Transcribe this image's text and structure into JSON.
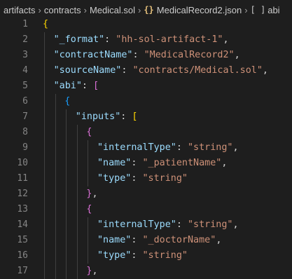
{
  "breadcrumb": {
    "parts": [
      "artifacts",
      "contracts",
      "Medical.sol",
      "MedicalRecord2.json",
      "abi"
    ],
    "json_icon": "{}",
    "array_icon": "[ ]"
  },
  "lines": [
    {
      "no": "1",
      "tokens": [
        {
          "t": "{",
          "c": "b1"
        }
      ],
      "indent": 0
    },
    {
      "no": "2",
      "tokens": [
        {
          "t": "\"_format\"",
          "c": "t-key"
        },
        {
          "t": ": ",
          "c": "t-punc"
        },
        {
          "t": "\"hh-sol-artifact-1\"",
          "c": "t-str"
        },
        {
          "t": ",",
          "c": "t-punc"
        }
      ],
      "indent": 1
    },
    {
      "no": "3",
      "tokens": [
        {
          "t": "\"contractName\"",
          "c": "t-key"
        },
        {
          "t": ": ",
          "c": "t-punc"
        },
        {
          "t": "\"MedicalRecord2\"",
          "c": "t-str"
        },
        {
          "t": ",",
          "c": "t-punc"
        }
      ],
      "indent": 1
    },
    {
      "no": "4",
      "tokens": [
        {
          "t": "\"sourceName\"",
          "c": "t-key"
        },
        {
          "t": ": ",
          "c": "t-punc"
        },
        {
          "t": "\"contracts/Medical.sol\"",
          "c": "t-str"
        },
        {
          "t": ",",
          "c": "t-punc"
        }
      ],
      "indent": 1
    },
    {
      "no": "5",
      "tokens": [
        {
          "t": "\"abi\"",
          "c": "t-key"
        },
        {
          "t": ": ",
          "c": "t-punc"
        },
        {
          "t": "[",
          "c": "b2"
        }
      ],
      "indent": 1
    },
    {
      "no": "6",
      "tokens": [
        {
          "t": "{",
          "c": "b3"
        }
      ],
      "indent": 2
    },
    {
      "no": "7",
      "tokens": [
        {
          "t": "\"inputs\"",
          "c": "t-key"
        },
        {
          "t": ": ",
          "c": "t-punc"
        },
        {
          "t": "[",
          "c": "b1"
        }
      ],
      "indent": 3
    },
    {
      "no": "8",
      "tokens": [
        {
          "t": "{",
          "c": "b2"
        }
      ],
      "indent": 4
    },
    {
      "no": "9",
      "tokens": [
        {
          "t": "\"internalType\"",
          "c": "t-key"
        },
        {
          "t": ": ",
          "c": "t-punc"
        },
        {
          "t": "\"string\"",
          "c": "t-str"
        },
        {
          "t": ",",
          "c": "t-punc"
        }
      ],
      "indent": 5
    },
    {
      "no": "10",
      "tokens": [
        {
          "t": "\"name\"",
          "c": "t-key"
        },
        {
          "t": ": ",
          "c": "t-punc"
        },
        {
          "t": "\"_patientName\"",
          "c": "t-str"
        },
        {
          "t": ",",
          "c": "t-punc"
        }
      ],
      "indent": 5
    },
    {
      "no": "11",
      "tokens": [
        {
          "t": "\"type\"",
          "c": "t-key"
        },
        {
          "t": ": ",
          "c": "t-punc"
        },
        {
          "t": "\"string\"",
          "c": "t-str"
        }
      ],
      "indent": 5
    },
    {
      "no": "12",
      "tokens": [
        {
          "t": "}",
          "c": "b2"
        },
        {
          "t": ",",
          "c": "t-punc"
        }
      ],
      "indent": 4
    },
    {
      "no": "13",
      "tokens": [
        {
          "t": "{",
          "c": "b2"
        }
      ],
      "indent": 4
    },
    {
      "no": "14",
      "tokens": [
        {
          "t": "\"internalType\"",
          "c": "t-key"
        },
        {
          "t": ": ",
          "c": "t-punc"
        },
        {
          "t": "\"string\"",
          "c": "t-str"
        },
        {
          "t": ",",
          "c": "t-punc"
        }
      ],
      "indent": 5
    },
    {
      "no": "15",
      "tokens": [
        {
          "t": "\"name\"",
          "c": "t-key"
        },
        {
          "t": ": ",
          "c": "t-punc"
        },
        {
          "t": "\"_doctorName\"",
          "c": "t-str"
        },
        {
          "t": ",",
          "c": "t-punc"
        }
      ],
      "indent": 5
    },
    {
      "no": "16",
      "tokens": [
        {
          "t": "\"type\"",
          "c": "t-key"
        },
        {
          "t": ": ",
          "c": "t-punc"
        },
        {
          "t": "\"string\"",
          "c": "t-str"
        }
      ],
      "indent": 5
    },
    {
      "no": "17",
      "tokens": [
        {
          "t": "}",
          "c": "b2"
        },
        {
          "t": ",",
          "c": "t-punc"
        }
      ],
      "indent": 4
    }
  ]
}
